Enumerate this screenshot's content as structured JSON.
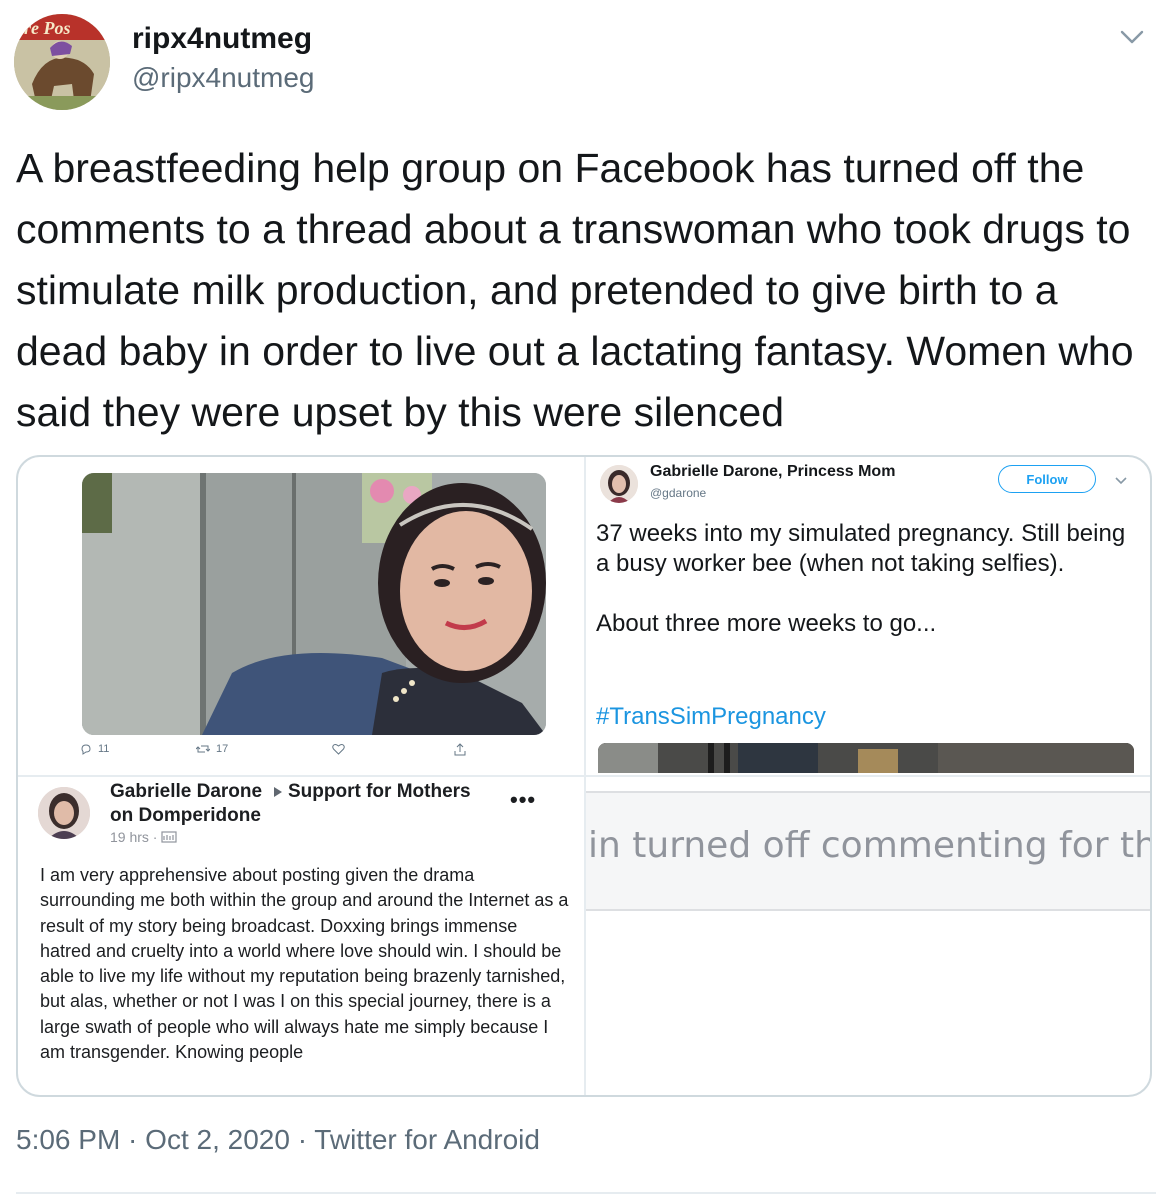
{
  "tweet": {
    "display_name": "ripx4nutmeg",
    "handle": "@ripx4nutmeg",
    "avatar_text": "re Pos",
    "text": "A breastfeeding help group on Facebook has turned off the comments to a thread about a transwoman who took drugs to stimulate milk production, and pretended to give birth to a dead baby in order to live out a lactating fantasy. Women who said they were upset by this were silenced",
    "timestamp": "5:06 PM · Oct 2, 2020 · Twitter for Android"
  },
  "embedded_photo_tweet": {
    "header_snippet": "#TransSimPregnancy",
    "actions": {
      "replies": "11",
      "retweets": "17"
    }
  },
  "embedded_tweet": {
    "name": "Gabrielle Darone, Princess Mom",
    "handle": "@gdarone",
    "follow_label": "Follow",
    "body": "37 weeks into my simulated pregnancy.  Still being a busy worker bee (when not taking selfies).\n\nAbout three more weeks to go...",
    "hashtag": "#TransSimPregnancy"
  },
  "facebook_post": {
    "author": "Gabrielle Darone",
    "group_line1": "Support for Mothers",
    "group_line2": "on Domperidone",
    "time": "19 hrs ·",
    "more": "•••",
    "text": "I am very apprehensive about posting given the drama surrounding me both within the group and around the Internet as a result of my story being broadcast. Doxxing brings immense hatred and cruelty into a world where love should win. I should be able to live my life without my reputation being brazenly tarnished, but alas, whether or not I was I on this special journey, there is a large swath of people who will always hate me simply because I am transgender. Knowing people"
  },
  "admin_notice": {
    "text": "in turned off commenting for thi"
  },
  "colors": {
    "text": "#14171a",
    "secondary": "#5b6b78",
    "link": "#1b95e0",
    "follow": "#1da1f2",
    "border": "#cfd9de"
  }
}
